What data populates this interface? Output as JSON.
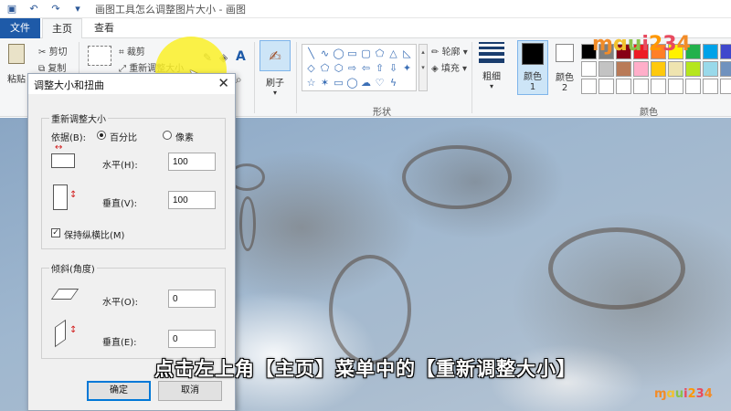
{
  "window": {
    "title": "画图工具怎么调整图片大小 - 画图"
  },
  "tabs": [
    {
      "label": "文件"
    },
    {
      "label": "主页"
    },
    {
      "label": "查看"
    }
  ],
  "ribbon": {
    "clipboard": {
      "paste": "粘贴",
      "cut": "剪切",
      "copy": "复制",
      "group": "剪"
    },
    "image": {
      "crop": "裁剪",
      "resize": "重新调整大小",
      "select": "选择"
    },
    "brushes": {
      "label": "刷子"
    },
    "shapes": {
      "outline": "轮廓",
      "fill": "填充",
      "group": "形状"
    },
    "size": {
      "label": "粗细"
    },
    "colors": {
      "color1": "颜色 1",
      "color2": "颜色 2",
      "group": "颜色"
    }
  },
  "palette": [
    "#000000",
    "#7f7f7f",
    "#880015",
    "#ed1c24",
    "#ff7f27",
    "#fff200",
    "#22b14c",
    "#00a2e8",
    "#3f48cc",
    "#a349a4",
    "#ffffff",
    "#c3c3c3",
    "#b97a57",
    "#ffaec9",
    "#ffc90e",
    "#efe4b0",
    "#b5e61d",
    "#99d9ea",
    "#7092be",
    "#c8bfe7",
    "#ffffff",
    "#ffffff",
    "#ffffff",
    "#ffffff",
    "#ffffff",
    "#ffffff",
    "#ffffff",
    "#ffffff",
    "#ffffff",
    "#ffffff"
  ],
  "dialog": {
    "title": "调整大小和扭曲",
    "resize_group": "重新调整大小",
    "by_label": "依据(B):",
    "percent": "百分比",
    "pixels": "像素",
    "horizontal_label": "水平(H):",
    "horizontal_value": "100",
    "vertical_label": "垂直(V):",
    "vertical_value": "100",
    "keep_ratio": "保持纵横比(M)",
    "skew_group": "倾斜(角度)",
    "skew_h_label": "水平(O):",
    "skew_h_value": "0",
    "skew_v_label": "垂直(E):",
    "skew_v_value": "0",
    "ok": "确定",
    "cancel": "取消"
  },
  "caption": "点击左上角【主页】菜单中的【重新调整大小】",
  "logos": [
    "ɱ",
    "ɑ",
    "u",
    "i",
    "2",
    "3",
    "4"
  ]
}
